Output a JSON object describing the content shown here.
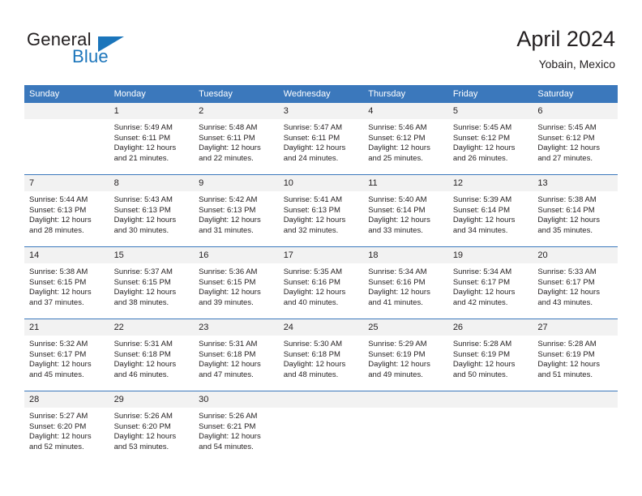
{
  "brand": {
    "name_part1": "General",
    "name_part2": "Blue"
  },
  "header": {
    "title": "April 2024",
    "subtitle": "Yobain, Mexico"
  },
  "colors": {
    "header_blue": "#3b78bc",
    "logo_blue": "#1b75bb",
    "daynum_band": "#f2f2f2",
    "text": "#231f20"
  },
  "weekdays": [
    "Sunday",
    "Monday",
    "Tuesday",
    "Wednesday",
    "Thursday",
    "Friday",
    "Saturday"
  ],
  "weeks": [
    [
      {
        "day": "",
        "blank": true
      },
      {
        "day": "1",
        "sunrise": "Sunrise: 5:49 AM",
        "sunset": "Sunset: 6:11 PM",
        "daylight_line1": "Daylight: 12 hours",
        "daylight_line2": "and 21 minutes."
      },
      {
        "day": "2",
        "sunrise": "Sunrise: 5:48 AM",
        "sunset": "Sunset: 6:11 PM",
        "daylight_line1": "Daylight: 12 hours",
        "daylight_line2": "and 22 minutes."
      },
      {
        "day": "3",
        "sunrise": "Sunrise: 5:47 AM",
        "sunset": "Sunset: 6:11 PM",
        "daylight_line1": "Daylight: 12 hours",
        "daylight_line2": "and 24 minutes."
      },
      {
        "day": "4",
        "sunrise": "Sunrise: 5:46 AM",
        "sunset": "Sunset: 6:12 PM",
        "daylight_line1": "Daylight: 12 hours",
        "daylight_line2": "and 25 minutes."
      },
      {
        "day": "5",
        "sunrise": "Sunrise: 5:45 AM",
        "sunset": "Sunset: 6:12 PM",
        "daylight_line1": "Daylight: 12 hours",
        "daylight_line2": "and 26 minutes."
      },
      {
        "day": "6",
        "sunrise": "Sunrise: 5:45 AM",
        "sunset": "Sunset: 6:12 PM",
        "daylight_line1": "Daylight: 12 hours",
        "daylight_line2": "and 27 minutes."
      }
    ],
    [
      {
        "day": "7",
        "sunrise": "Sunrise: 5:44 AM",
        "sunset": "Sunset: 6:13 PM",
        "daylight_line1": "Daylight: 12 hours",
        "daylight_line2": "and 28 minutes."
      },
      {
        "day": "8",
        "sunrise": "Sunrise: 5:43 AM",
        "sunset": "Sunset: 6:13 PM",
        "daylight_line1": "Daylight: 12 hours",
        "daylight_line2": "and 30 minutes."
      },
      {
        "day": "9",
        "sunrise": "Sunrise: 5:42 AM",
        "sunset": "Sunset: 6:13 PM",
        "daylight_line1": "Daylight: 12 hours",
        "daylight_line2": "and 31 minutes."
      },
      {
        "day": "10",
        "sunrise": "Sunrise: 5:41 AM",
        "sunset": "Sunset: 6:13 PM",
        "daylight_line1": "Daylight: 12 hours",
        "daylight_line2": "and 32 minutes."
      },
      {
        "day": "11",
        "sunrise": "Sunrise: 5:40 AM",
        "sunset": "Sunset: 6:14 PM",
        "daylight_line1": "Daylight: 12 hours",
        "daylight_line2": "and 33 minutes."
      },
      {
        "day": "12",
        "sunrise": "Sunrise: 5:39 AM",
        "sunset": "Sunset: 6:14 PM",
        "daylight_line1": "Daylight: 12 hours",
        "daylight_line2": "and 34 minutes."
      },
      {
        "day": "13",
        "sunrise": "Sunrise: 5:38 AM",
        "sunset": "Sunset: 6:14 PM",
        "daylight_line1": "Daylight: 12 hours",
        "daylight_line2": "and 35 minutes."
      }
    ],
    [
      {
        "day": "14",
        "sunrise": "Sunrise: 5:38 AM",
        "sunset": "Sunset: 6:15 PM",
        "daylight_line1": "Daylight: 12 hours",
        "daylight_line2": "and 37 minutes."
      },
      {
        "day": "15",
        "sunrise": "Sunrise: 5:37 AM",
        "sunset": "Sunset: 6:15 PM",
        "daylight_line1": "Daylight: 12 hours",
        "daylight_line2": "and 38 minutes."
      },
      {
        "day": "16",
        "sunrise": "Sunrise: 5:36 AM",
        "sunset": "Sunset: 6:15 PM",
        "daylight_line1": "Daylight: 12 hours",
        "daylight_line2": "and 39 minutes."
      },
      {
        "day": "17",
        "sunrise": "Sunrise: 5:35 AM",
        "sunset": "Sunset: 6:16 PM",
        "daylight_line1": "Daylight: 12 hours",
        "daylight_line2": "and 40 minutes."
      },
      {
        "day": "18",
        "sunrise": "Sunrise: 5:34 AM",
        "sunset": "Sunset: 6:16 PM",
        "daylight_line1": "Daylight: 12 hours",
        "daylight_line2": "and 41 minutes."
      },
      {
        "day": "19",
        "sunrise": "Sunrise: 5:34 AM",
        "sunset": "Sunset: 6:17 PM",
        "daylight_line1": "Daylight: 12 hours",
        "daylight_line2": "and 42 minutes."
      },
      {
        "day": "20",
        "sunrise": "Sunrise: 5:33 AM",
        "sunset": "Sunset: 6:17 PM",
        "daylight_line1": "Daylight: 12 hours",
        "daylight_line2": "and 43 minutes."
      }
    ],
    [
      {
        "day": "21",
        "sunrise": "Sunrise: 5:32 AM",
        "sunset": "Sunset: 6:17 PM",
        "daylight_line1": "Daylight: 12 hours",
        "daylight_line2": "and 45 minutes."
      },
      {
        "day": "22",
        "sunrise": "Sunrise: 5:31 AM",
        "sunset": "Sunset: 6:18 PM",
        "daylight_line1": "Daylight: 12 hours",
        "daylight_line2": "and 46 minutes."
      },
      {
        "day": "23",
        "sunrise": "Sunrise: 5:31 AM",
        "sunset": "Sunset: 6:18 PM",
        "daylight_line1": "Daylight: 12 hours",
        "daylight_line2": "and 47 minutes."
      },
      {
        "day": "24",
        "sunrise": "Sunrise: 5:30 AM",
        "sunset": "Sunset: 6:18 PM",
        "daylight_line1": "Daylight: 12 hours",
        "daylight_line2": "and 48 minutes."
      },
      {
        "day": "25",
        "sunrise": "Sunrise: 5:29 AM",
        "sunset": "Sunset: 6:19 PM",
        "daylight_line1": "Daylight: 12 hours",
        "daylight_line2": "and 49 minutes."
      },
      {
        "day": "26",
        "sunrise": "Sunrise: 5:28 AM",
        "sunset": "Sunset: 6:19 PM",
        "daylight_line1": "Daylight: 12 hours",
        "daylight_line2": "and 50 minutes."
      },
      {
        "day": "27",
        "sunrise": "Sunrise: 5:28 AM",
        "sunset": "Sunset: 6:19 PM",
        "daylight_line1": "Daylight: 12 hours",
        "daylight_line2": "and 51 minutes."
      }
    ],
    [
      {
        "day": "28",
        "sunrise": "Sunrise: 5:27 AM",
        "sunset": "Sunset: 6:20 PM",
        "daylight_line1": "Daylight: 12 hours",
        "daylight_line2": "and 52 minutes."
      },
      {
        "day": "29",
        "sunrise": "Sunrise: 5:26 AM",
        "sunset": "Sunset: 6:20 PM",
        "daylight_line1": "Daylight: 12 hours",
        "daylight_line2": "and 53 minutes."
      },
      {
        "day": "30",
        "sunrise": "Sunrise: 5:26 AM",
        "sunset": "Sunset: 6:21 PM",
        "daylight_line1": "Daylight: 12 hours",
        "daylight_line2": "and 54 minutes."
      },
      {
        "day": "",
        "blank": true
      },
      {
        "day": "",
        "blank": true
      },
      {
        "day": "",
        "blank": true
      },
      {
        "day": "",
        "blank": true
      }
    ]
  ]
}
